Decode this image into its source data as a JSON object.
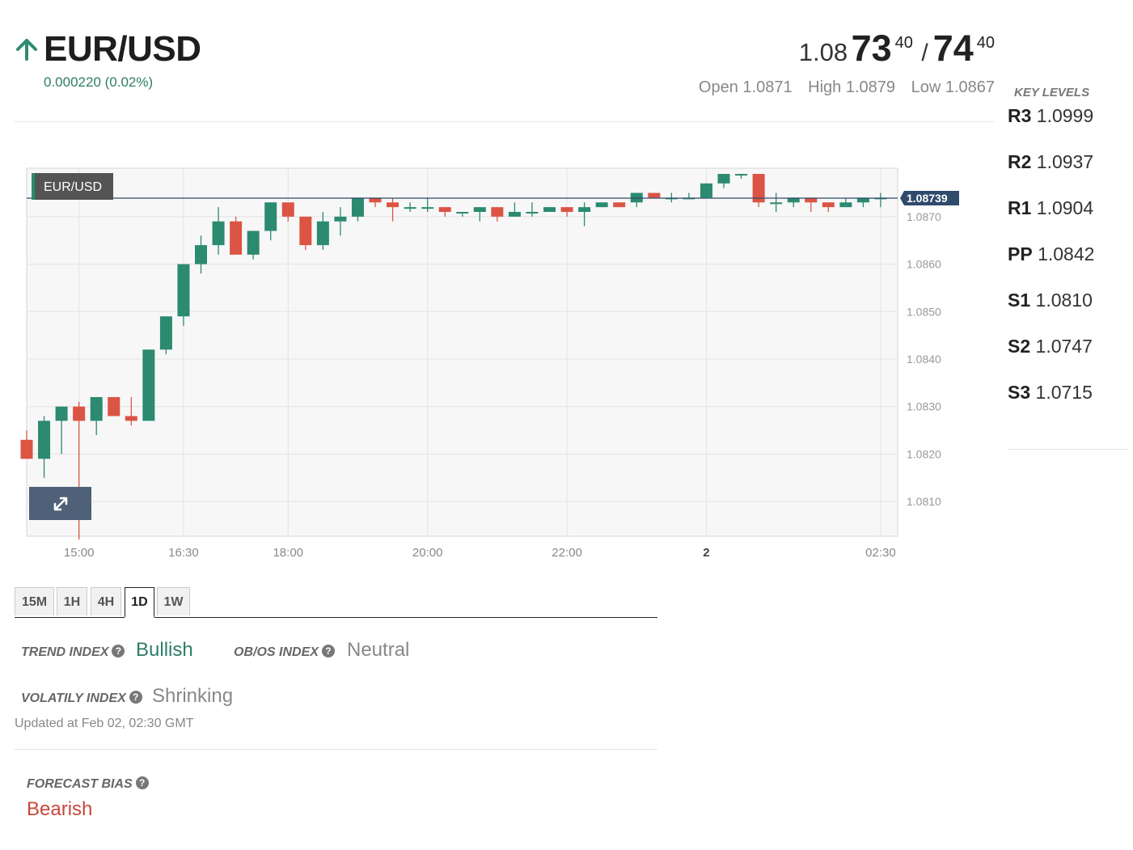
{
  "header": {
    "pair": "EUR/USD",
    "change": "0.000220 (0.02%)",
    "quote": {
      "bid_small": "1.08",
      "bid_big": "73",
      "bid_sup": "40",
      "slash": "/",
      "ask_big": "74",
      "ask_sup": "40"
    },
    "open": "Open 1.0871",
    "high": "High 1.0879",
    "low": "Low 1.0867"
  },
  "key_levels": {
    "title": "KEY LEVELS",
    "items": [
      {
        "name": "R3",
        "value": "1.0999"
      },
      {
        "name": "R2",
        "value": "1.0937"
      },
      {
        "name": "R1",
        "value": "1.0904"
      },
      {
        "name": "PP",
        "value": "1.0842"
      },
      {
        "name": "S1",
        "value": "1.0810"
      },
      {
        "name": "S2",
        "value": "1.0747"
      },
      {
        "name": "S3",
        "value": "1.0715"
      }
    ]
  },
  "tabs": [
    "15M",
    "1H",
    "4H",
    "1D",
    "1W"
  ],
  "active_tab": "1D",
  "indices": {
    "trend_label": "TREND INDEX",
    "trend_value": "Bullish",
    "obos_label": "OB/OS INDEX",
    "obos_value": "Neutral",
    "volatility_label": "VOLATILY INDEX",
    "volatility_value": "Shrinking",
    "updated": "Updated at Feb 02, 02:30 GMT"
  },
  "forecast": {
    "label": "FORECAST BIAS",
    "value": "Bearish"
  },
  "colors": {
    "up": "#2b8a70",
    "down": "#db5444",
    "positive_text": "#2e7d67",
    "negative_text": "#c8473a",
    "neutral_text": "#888888"
  },
  "icons": {
    "arrow": "arrow-up-icon",
    "help": "help-icon",
    "expand": "expand-icon"
  },
  "chart_data": {
    "type": "candlestick",
    "symbol_label": "EUR/USD",
    "last_price": 1.08739,
    "last_price_label": "1.08739",
    "ylim": [
      1.08027,
      1.08802
    ],
    "y_ticks": [
      1.081,
      1.082,
      1.083,
      1.084,
      1.085,
      1.086,
      1.087
    ],
    "y_tick_labels": [
      "1.0810",
      "1.0820",
      "1.0830",
      "1.0840",
      "1.0850",
      "1.0860",
      "1.0870"
    ],
    "x_ticks": [
      {
        "label": "15:00",
        "index": 3
      },
      {
        "label": "16:30",
        "index": 9
      },
      {
        "label": "18:00",
        "index": 15
      },
      {
        "label": "20:00",
        "index": 23
      },
      {
        "label": "22:00",
        "index": 31
      },
      {
        "label": "2",
        "index": 39
      },
      {
        "label": "02:30",
        "index": 49
      }
    ],
    "bar_interval": "15 min",
    "candles": [
      {
        "o": 1.0823,
        "h": 1.0825,
        "l": 1.0819,
        "c": 1.0819
      },
      {
        "o": 1.0819,
        "h": 1.0828,
        "l": 1.0815,
        "c": 1.0827
      },
      {
        "o": 1.0827,
        "h": 1.083,
        "l": 1.082,
        "c": 1.083
      },
      {
        "o": 1.083,
        "h": 1.0831,
        "l": 1.0802,
        "c": 1.0827
      },
      {
        "o": 1.0827,
        "h": 1.0832,
        "l": 1.0824,
        "c": 1.0832
      },
      {
        "o": 1.0832,
        "h": 1.0832,
        "l": 1.0828,
        "c": 1.0828
      },
      {
        "o": 1.0828,
        "h": 1.0832,
        "l": 1.0826,
        "c": 1.0827
      },
      {
        "o": 1.0827,
        "h": 1.0842,
        "l": 1.0827,
        "c": 1.0842
      },
      {
        "o": 1.0842,
        "h": 1.0848,
        "l": 1.0841,
        "c": 1.0849
      },
      {
        "o": 1.0849,
        "h": 1.086,
        "l": 1.0847,
        "c": 1.086
      },
      {
        "o": 1.086,
        "h": 1.0866,
        "l": 1.0858,
        "c": 1.0864
      },
      {
        "o": 1.0864,
        "h": 1.0872,
        "l": 1.0862,
        "c": 1.0869
      },
      {
        "o": 1.0869,
        "h": 1.087,
        "l": 1.0862,
        "c": 1.0862
      },
      {
        "o": 1.0862,
        "h": 1.0867,
        "l": 1.0861,
        "c": 1.0867
      },
      {
        "o": 1.0867,
        "h": 1.0873,
        "l": 1.0865,
        "c": 1.0873
      },
      {
        "o": 1.0873,
        "h": 1.0873,
        "l": 1.0869,
        "c": 1.087
      },
      {
        "o": 1.087,
        "h": 1.087,
        "l": 1.0863,
        "c": 1.0864
      },
      {
        "o": 1.0864,
        "h": 1.0871,
        "l": 1.0863,
        "c": 1.0869
      },
      {
        "o": 1.0869,
        "h": 1.0872,
        "l": 1.0866,
        "c": 1.087
      },
      {
        "o": 1.087,
        "h": 1.0874,
        "l": 1.0869,
        "c": 1.0874
      },
      {
        "o": 1.0874,
        "h": 1.0874,
        "l": 1.0872,
        "c": 1.0873
      },
      {
        "o": 1.0873,
        "h": 1.0874,
        "l": 1.0869,
        "c": 1.0872
      },
      {
        "o": 1.0872,
        "h": 1.0873,
        "l": 1.0871,
        "c": 1.0872
      },
      {
        "o": 1.0872,
        "h": 1.0874,
        "l": 1.0871,
        "c": 1.0872
      },
      {
        "o": 1.0872,
        "h": 1.0872,
        "l": 1.087,
        "c": 1.0871
      },
      {
        "o": 1.0871,
        "h": 1.0871,
        "l": 1.087,
        "c": 1.0871
      },
      {
        "o": 1.0871,
        "h": 1.0872,
        "l": 1.0869,
        "c": 1.0872
      },
      {
        "o": 1.0872,
        "h": 1.0872,
        "l": 1.0869,
        "c": 1.087
      },
      {
        "o": 1.087,
        "h": 1.0873,
        "l": 1.087,
        "c": 1.0871
      },
      {
        "o": 1.0871,
        "h": 1.0873,
        "l": 1.087,
        "c": 1.0871
      },
      {
        "o": 1.0871,
        "h": 1.0872,
        "l": 1.0871,
        "c": 1.0872
      },
      {
        "o": 1.0872,
        "h": 1.0872,
        "l": 1.087,
        "c": 1.0871
      },
      {
        "o": 1.0871,
        "h": 1.0873,
        "l": 1.0868,
        "c": 1.0872
      },
      {
        "o": 1.0872,
        "h": 1.0873,
        "l": 1.0872,
        "c": 1.0873
      },
      {
        "o": 1.0873,
        "h": 1.0873,
        "l": 1.0872,
        "c": 1.0872
      },
      {
        "o": 1.0873,
        "h": 1.0875,
        "l": 1.0872,
        "c": 1.0875
      },
      {
        "o": 1.0875,
        "h": 1.0875,
        "l": 1.0874,
        "c": 1.0874
      },
      {
        "o": 1.0874,
        "h": 1.0875,
        "l": 1.0873,
        "c": 1.0874
      },
      {
        "o": 1.0874,
        "h": 1.0875,
        "l": 1.0874,
        "c": 1.0874
      },
      {
        "o": 1.0874,
        "h": 1.0877,
        "l": 1.0874,
        "c": 1.0877
      },
      {
        "o": 1.0877,
        "h": 1.0879,
        "l": 1.0876,
        "c": 1.0879
      },
      {
        "o": 1.0879,
        "h": 1.0879,
        "l": 1.0878,
        "c": 1.0879
      },
      {
        "o": 1.0879,
        "h": 1.0879,
        "l": 1.0872,
        "c": 1.0873
      },
      {
        "o": 1.0873,
        "h": 1.0875,
        "l": 1.0871,
        "c": 1.0873
      },
      {
        "o": 1.0873,
        "h": 1.0874,
        "l": 1.0872,
        "c": 1.0874
      },
      {
        "o": 1.0874,
        "h": 1.0874,
        "l": 1.0871,
        "c": 1.0873
      },
      {
        "o": 1.0873,
        "h": 1.0873,
        "l": 1.0871,
        "c": 1.0872
      },
      {
        "o": 1.0872,
        "h": 1.0874,
        "l": 1.0872,
        "c": 1.0873
      },
      {
        "o": 1.0873,
        "h": 1.0874,
        "l": 1.0872,
        "c": 1.0874
      },
      {
        "o": 1.0874,
        "h": 1.0875,
        "l": 1.0872,
        "c": 1.0874
      }
    ]
  }
}
